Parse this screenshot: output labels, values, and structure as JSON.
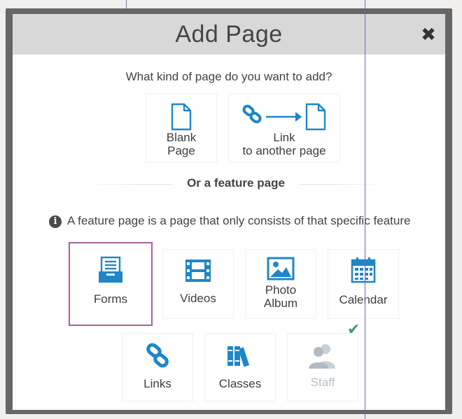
{
  "dialog": {
    "title": "Add Page",
    "close_label": "✖",
    "question": "What kind of page do you want to add?",
    "page_types": [
      {
        "label_line1": "Blank",
        "label_line2": "Page",
        "icon": "blank-page-icon"
      },
      {
        "label_line1": "Link",
        "label_line2": "to another page",
        "icon": "link-to-page-icon"
      }
    ],
    "divider_label": "Or a feature page",
    "info_text": "A feature page is a page that only consists of that specific feature",
    "features": [
      {
        "label_line1": "Forms",
        "label_line2": "",
        "icon": "forms-icon",
        "selected": true
      },
      {
        "label_line1": "Videos",
        "label_line2": "",
        "icon": "film-icon"
      },
      {
        "label_line1": "Photo",
        "label_line2": "Album",
        "icon": "photo-icon"
      },
      {
        "label_line1": "Calendar",
        "label_line2": "",
        "icon": "calendar-icon"
      },
      {
        "label_line1": "Links",
        "label_line2": "",
        "icon": "chain-link-icon"
      },
      {
        "label_line1": "Classes",
        "label_line2": "",
        "icon": "books-icon"
      },
      {
        "label_line1": "Staff",
        "label_line2": "",
        "icon": "staff-icon",
        "disabled": true,
        "checked": true
      }
    ]
  },
  "colors": {
    "accent_blue": "#1f86c8",
    "selected_border": "#a8609a",
    "check_green": "#3f9a6b",
    "header_bg": "#d8d8d8",
    "overlay": "#666666"
  }
}
